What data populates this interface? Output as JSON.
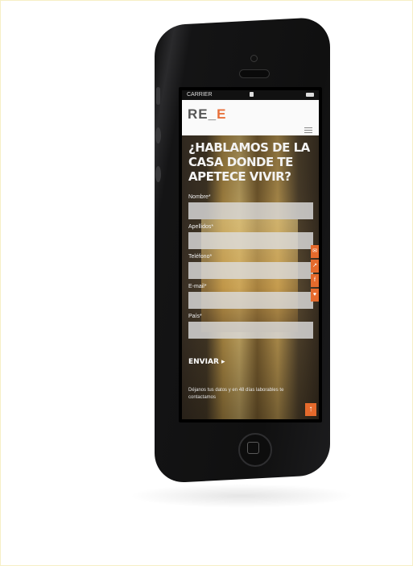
{
  "status_bar": {
    "carrier": "CARRIER"
  },
  "header": {
    "logo_left": "RE_",
    "logo_right": "E"
  },
  "headline": "¿HABLAMOS DE LA CASA DONDE TE APETECE VIVIR?",
  "form": {
    "fields": [
      {
        "label": "Nombre*"
      },
      {
        "label": "Apellidos*"
      },
      {
        "label": "Teléfono*"
      },
      {
        "label": "E-mail*"
      },
      {
        "label": "País*"
      }
    ],
    "submit_label": "ENVIAR ▸"
  },
  "note": "Déjanos tus datos y en 48 días laborables te contactamos",
  "side_tabs": [
    "✉",
    "↗",
    "f",
    "♥"
  ],
  "scroll_top_icon": "↑",
  "colors": {
    "accent": "#e56a2c",
    "phone_body": "#141415"
  }
}
